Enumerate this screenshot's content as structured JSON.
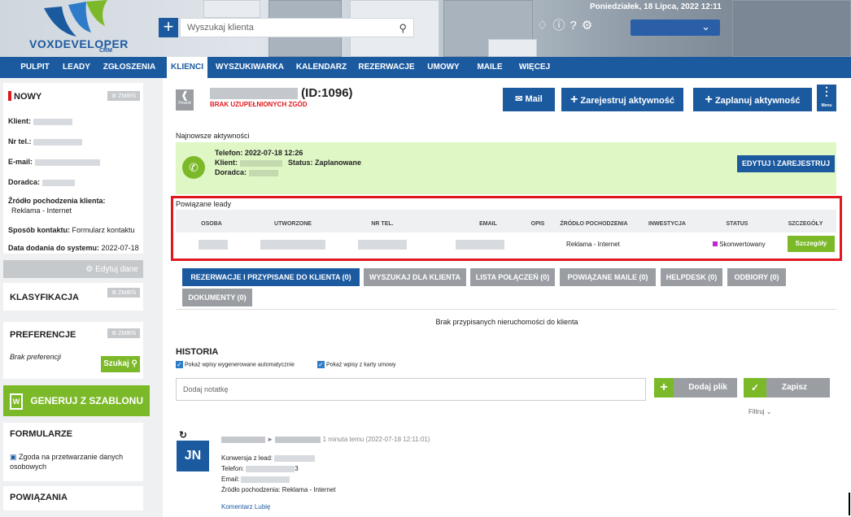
{
  "header": {
    "logo_text": "VOXDEVELOPER",
    "logo_sub": "CRM",
    "search_placeholder": "Wyszukaj klienta",
    "date": "Poniedziałek, 18 Lipca, 2022 12:11",
    "icons": [
      "bell-icon",
      "info-icon",
      "help-icon",
      "gear-icon"
    ]
  },
  "nav": [
    {
      "label": "PULPIT"
    },
    {
      "label": "LEADY"
    },
    {
      "label": "ZGŁOSZENIA"
    },
    {
      "label": "KLIENCI"
    },
    {
      "label": "WYSZUKIWARKA"
    },
    {
      "label": "KALENDARZ"
    },
    {
      "label": "REZERWACJE"
    },
    {
      "label": "UMOWY"
    },
    {
      "label": "MAILE"
    },
    {
      "label": "WIĘCEJ"
    }
  ],
  "left": {
    "status": "NOWY",
    "change_label": "ZMIEŃ",
    "client_label": "Klient:",
    "phone_label": "Nr tel.:",
    "email_label": "E-mail:",
    "advisor_label": "Doradca:",
    "source_label": "Źródło pochodzenia klienta:",
    "source_value": "Reklama - Internet",
    "contact_label": "Sposób kontaktu:",
    "contact_value": "Formularz kontaktu",
    "date_label": "Data dodania do systemu:",
    "date_value": "2022-07-18",
    "edit_label": "Edytuj dane",
    "classification": "KLASYFIKACJA",
    "preferences": "PREFERENCJE",
    "no_prefs": "Brak preferencji",
    "search_btn": "Szukaj",
    "generate_btn": "GENERUJ Z SZABLONU",
    "forms_title": "FORMULARZE",
    "form_item": "Zgoda na przetwarzanie danych osobowych",
    "links_title": "POWIĄZANIA"
  },
  "main": {
    "back_label": "Powrót",
    "client_title": "(ID:1096)",
    "no_consents": "BRAK UZUPEŁNIONYCH ZGÓD",
    "mail_btn": "Mail",
    "register_btn": "Zarejestruj aktywność",
    "plan_btn": "Zaplanuj aktywność",
    "menu_label": "Menu",
    "latest_title": "Najnowsze aktywności",
    "phone_line": "Telefon: 2022-07-18 12:26",
    "client_line": "Klient:",
    "status_line": "Status: Zaplanowane",
    "advisor_line": "Doradca:",
    "edit_register_btn": "EDYTUJ \\ ZAREJESTRUJ",
    "leads_title": "Powiązane leady",
    "leads_headers": [
      "OSOBA",
      "UTWORZONE",
      "NR TEL.",
      "EMAIL",
      "OPIS",
      "ŹRÓDŁO POCHODZENIA",
      "INWESTYCJA",
      "STATUS",
      "SZCZEGÓŁY"
    ],
    "lead_source": "Reklama - Internet",
    "lead_status": "Skonwertowany",
    "details_btn": "Szczegóły",
    "tabs": [
      {
        "label": "REZERWACJE I PRZYPISANE DO KLIENTA (0)"
      },
      {
        "label": "WYSZUKAJ DLA KLIENTA"
      },
      {
        "label": "LISTA POŁĄCZEŃ (0)"
      },
      {
        "label": "POWIĄZANE MAILE (0)"
      },
      {
        "label": "HELPDESK (0)"
      },
      {
        "label": "ODBIORY (0)"
      },
      {
        "label": "DOKUMENTY (0)"
      }
    ],
    "no_properties": "Brak przypisanych nieruchomości do klienta",
    "history_title": "HISTORIA",
    "check_auto": "Pokaż wpisy wygenerowane automatycznie",
    "check_contract": "Pokaż wpisy z karty umowy",
    "note_placeholder": "Dodaj notatkę",
    "add_file_btn": "Dodaj plik",
    "save_btn": "Zapisz",
    "filter_label": "Filtruj",
    "feed_avatar": "JN",
    "feed_time": "1 minuta temu (2022-07-18 12:11:01)",
    "feed_conversion": "Konwersja z lead:",
    "feed_phone": "Telefon:",
    "feed_phone_tail": "3",
    "feed_email": "Email:",
    "feed_source": "Źródło pochodzenia: Reklama - Internet",
    "feed_comment": "Komentarz",
    "feed_like": "Lubię"
  },
  "colors": {
    "brand": "#1c5aa0",
    "green": "#7cb928",
    "red_frame": "#e0181e",
    "activity_bg": "#dff6c5",
    "status_magenta": "#c026d3"
  }
}
